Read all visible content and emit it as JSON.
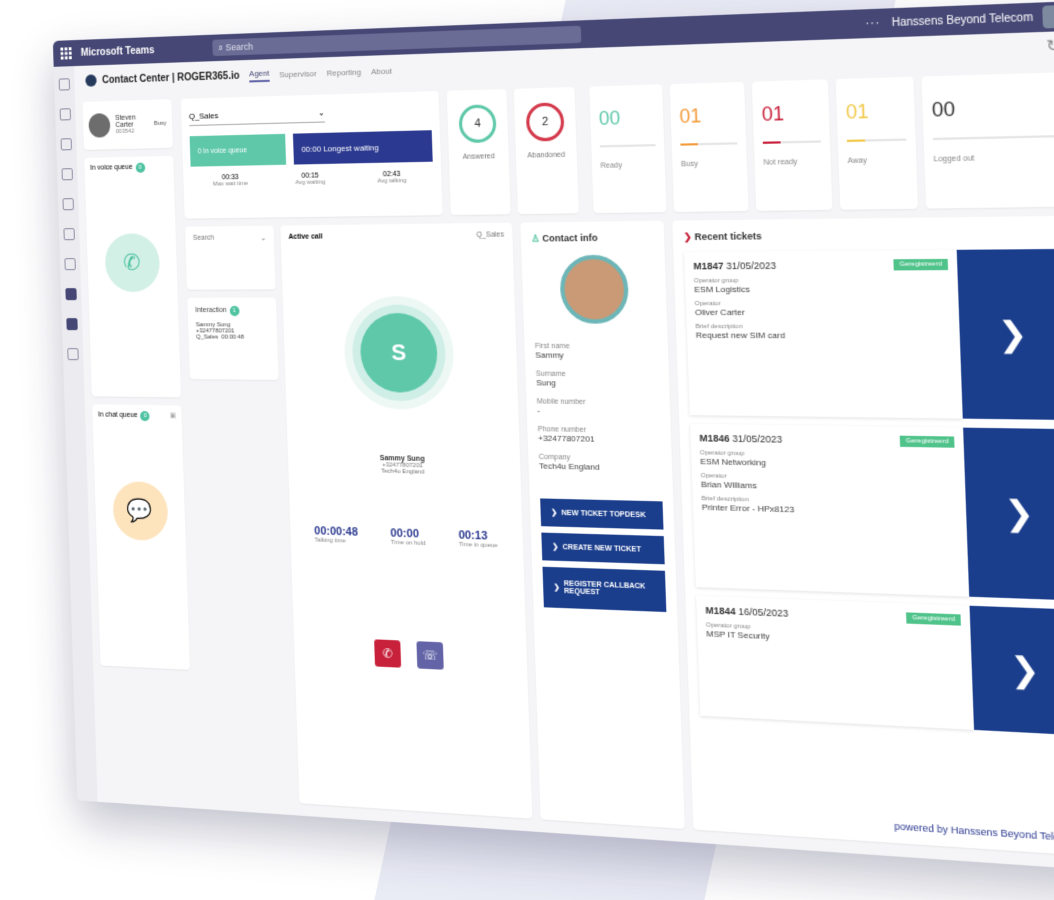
{
  "topbar": {
    "app_name": "Microsoft Teams",
    "search_placeholder": "Search",
    "more": "···",
    "tenant": "Hanssens Beyond Telecom"
  },
  "header": {
    "title": "Contact Center | ROGER365.io",
    "tabs": [
      "Agent",
      "Supervisor",
      "Reporting",
      "About"
    ]
  },
  "agent": {
    "name": "Steven Carter",
    "number": "003542",
    "status": "Busy"
  },
  "queues": {
    "voice_label": "In voice queue",
    "voice_count": "0",
    "chat_label": "In chat queue",
    "chat_count": "0"
  },
  "kpi": {
    "queue_select": "Q_Sales",
    "in_queue": "0  In voice queue",
    "longest_waiting": "00:00  Longest waiting",
    "stats": [
      {
        "value": "00:33",
        "label": "Max wait time"
      },
      {
        "value": "00:15",
        "label": "Avg waiting"
      },
      {
        "value": "02:43",
        "label": "Avg talking"
      }
    ]
  },
  "rings": [
    {
      "value": "4",
      "label": "Answered",
      "color": "#5ec8a9"
    },
    {
      "value": "2",
      "label": "Abandoned",
      "color": "#d3394b"
    }
  ],
  "statuses": [
    {
      "value": "00",
      "label": "Ready",
      "color": "#5ec8a9",
      "fill": 0
    },
    {
      "value": "01",
      "label": "Busy",
      "color": "#f39c3c",
      "fill": 0.3
    },
    {
      "value": "01",
      "label": "Not ready",
      "color": "#c8213b",
      "fill": 0.3
    },
    {
      "value": "01",
      "label": "Away",
      "color": "#f2c94c",
      "fill": 0.3
    },
    {
      "value": "00",
      "label": "Logged out",
      "color": "#333333",
      "fill": 0
    }
  ],
  "search": {
    "label": "Search"
  },
  "interaction": {
    "title": "Interaction",
    "count": "1",
    "name": "Sammy Sung",
    "number": "+32477807201",
    "queue": "Q_Sales",
    "time": "00:00:48"
  },
  "active_call": {
    "title": "Active call",
    "queue": "Q_Sales",
    "initial": "S",
    "name": "Sammy Sung",
    "number": "+32477807201",
    "company": "Tech4u England",
    "timers": [
      {
        "value": "00:00:48",
        "label": "Talking time"
      },
      {
        "value": "00:00",
        "label": "Time on hold"
      },
      {
        "value": "00:13",
        "label": "Time in queue"
      }
    ]
  },
  "contact": {
    "title": "Contact info",
    "fields": [
      {
        "label": "First name",
        "value": "Sammy"
      },
      {
        "label": "Surname",
        "value": "Sung"
      },
      {
        "label": "Mobile number",
        "value": "-"
      },
      {
        "label": "Phone number",
        "value": "+32477807201"
      },
      {
        "label": "Company",
        "value": "Tech4u England"
      }
    ],
    "buttons": [
      "NEW TICKET TOPDESK",
      "CREATE NEW TICKET",
      "REGISTER CALLBACK REQUEST"
    ]
  },
  "tickets": {
    "title": "Recent tickets",
    "items": [
      {
        "id": "M1847",
        "date": "31/05/2023",
        "status": "Geregistreerd",
        "group_label": "Operator group",
        "group": "ESM Logistics",
        "operator_label": "Operator",
        "operator": "Oliver Carter",
        "desc_label": "Brief description",
        "desc": "Request new SIM card"
      },
      {
        "id": "M1846",
        "date": "31/05/2023",
        "status": "Geregistreerd",
        "group_label": "Operator group",
        "group": "ESM Networking",
        "operator_label": "Operator",
        "operator": "Brian Williams",
        "desc_label": "Brief description",
        "desc": "Printer Error - HPx8123"
      },
      {
        "id": "M1844",
        "date": "16/05/2023",
        "status": "Geregistreerd",
        "group_label": "Operator group",
        "group": "MSP IT Security",
        "operator_label": "",
        "operator": "",
        "desc_label": "",
        "desc": ""
      }
    ]
  },
  "footer": {
    "powered": "powered by Hanssens Beyond Telecom"
  }
}
